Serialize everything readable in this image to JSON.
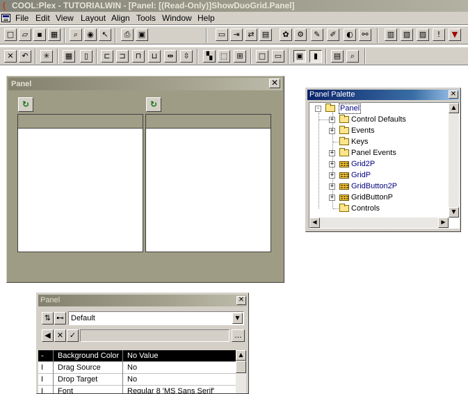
{
  "app": {
    "title": "COOL:Plex - TUTORIALWIN - [Panel:  [(Read-Only)]ShowDuoGrid.Panel]"
  },
  "menubar": {
    "items": [
      "File",
      "Edit",
      "View",
      "Layout",
      "Align",
      "Tools",
      "Window",
      "Help"
    ]
  },
  "toolbar1": {
    "icons": [
      "new-icon",
      "open-icon",
      "save-icon",
      "save-all-icon",
      "find-icon",
      "properties-icon",
      "pointer-icon",
      "print-icon",
      "preview-icon",
      "comment-icon",
      "export-icon",
      "transfer-icon",
      "model-icon",
      "palette-icon",
      "settings-icon",
      "wrench-icon",
      "editor-icon",
      "info-icon",
      "link-icon",
      "panel-icon",
      "report-icon",
      "function-icon",
      "warning-icon",
      "flag-icon"
    ]
  },
  "toolbar2": {
    "icons": [
      "delete-icon",
      "undo-icon",
      "asterisk-icon",
      "grid-icon",
      "text-icon",
      "align-left-icon",
      "align-right-icon",
      "align-top-icon",
      "align-bottom-icon",
      "distribute-h-icon",
      "distribute-v-icon",
      "order-icon",
      "select-all-icon",
      "group-icon",
      "box-icon",
      "field-icon",
      "panel-view-icon",
      "split-icon",
      "frame-icon",
      "zoom-icon"
    ]
  },
  "panel_window": {
    "title": "Panel",
    "close_glyph": "✕",
    "refresh_glyph": "↻"
  },
  "palette": {
    "title": "Panel Palette",
    "close_glyph": "✕",
    "tree": {
      "root": "Panel",
      "children": [
        "Control Defaults",
        "Events",
        "Keys",
        "Panel Events",
        "Grid2P",
        "GridP",
        "GridButton2P",
        "GridButtonP",
        "Controls"
      ]
    }
  },
  "props": {
    "title": "Panel",
    "close_glyph": "✕",
    "combo_value": "Default",
    "ellipsis": "...",
    "rows": [
      {
        "marker": "-",
        "name": "Background Color",
        "value": "No Value"
      },
      {
        "marker": "I",
        "name": "Drag Source",
        "value": "No"
      },
      {
        "marker": "I",
        "name": "Drop Target",
        "value": "No"
      },
      {
        "marker": "I",
        "name": "Font",
        "value": "Regular 8 'MS Sans Serif'"
      }
    ]
  }
}
